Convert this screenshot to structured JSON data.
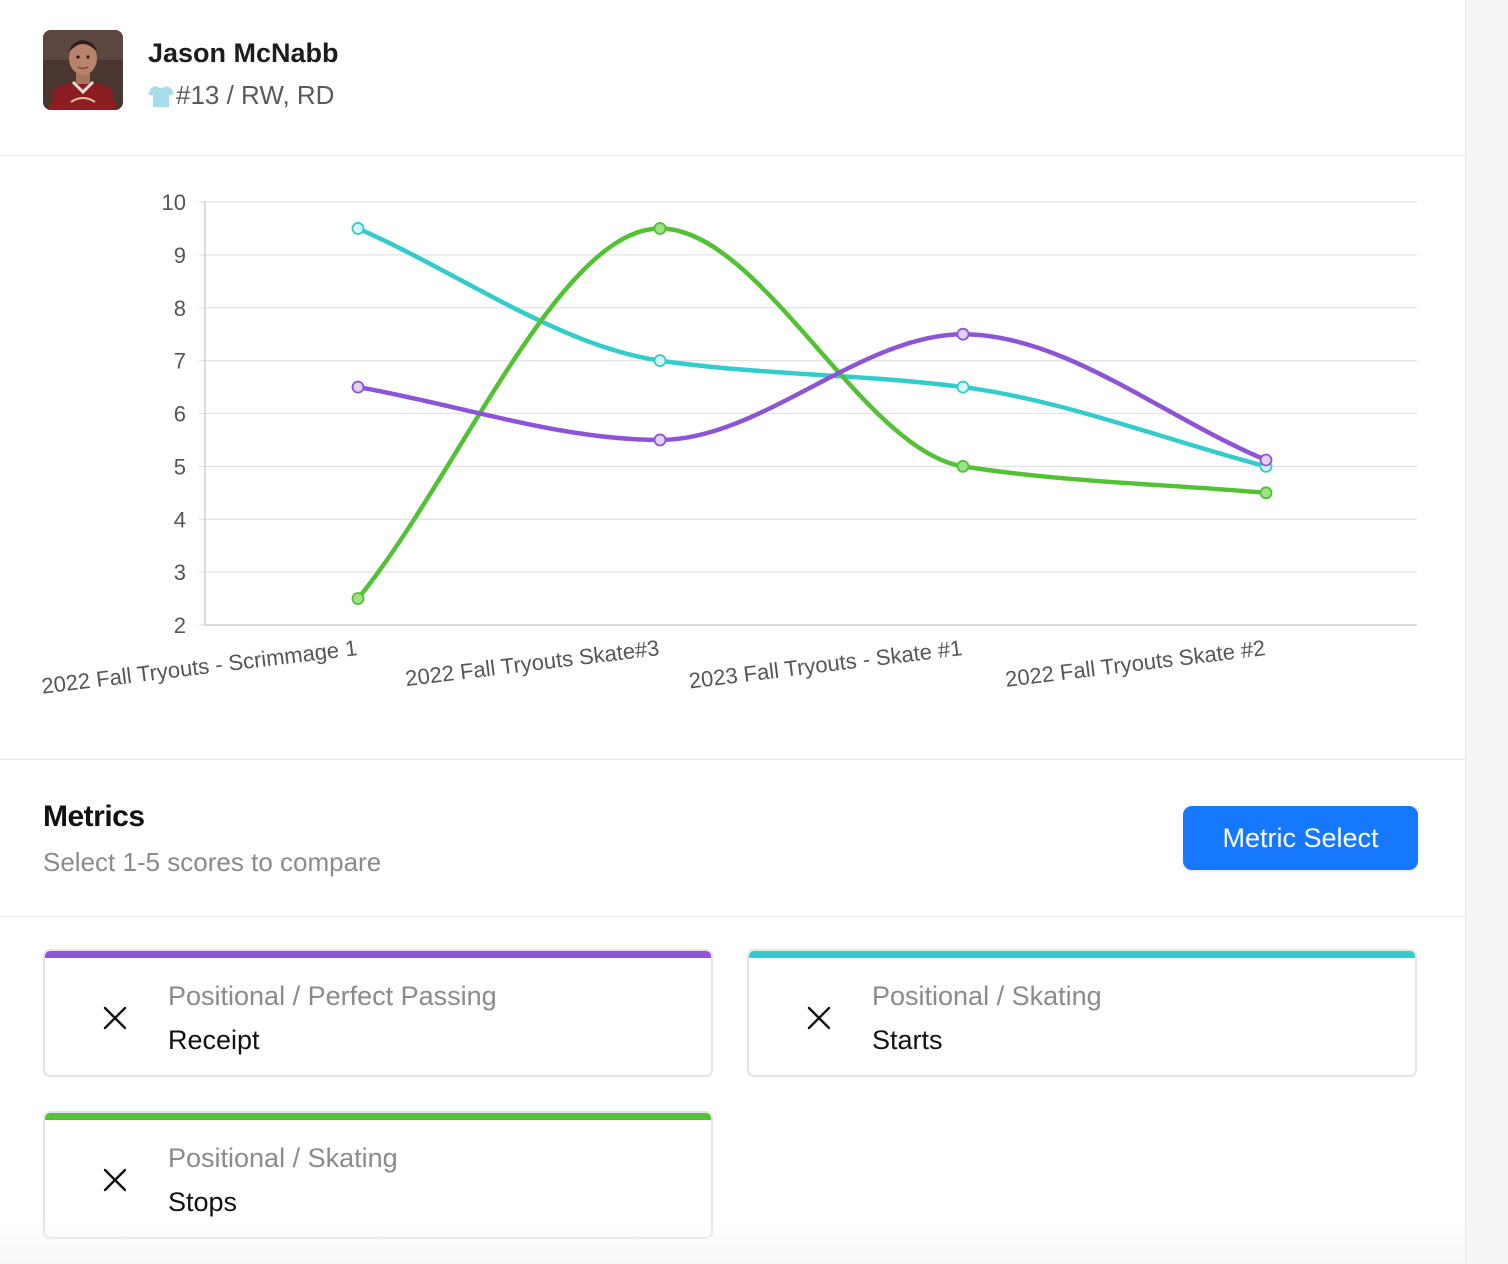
{
  "player": {
    "name": "Jason McNabb",
    "meta": "#13 / RW, RD",
    "jersey_icon": "jersey-icon"
  },
  "chart_data": {
    "type": "line",
    "categories": [
      "2022 Fall Tryouts - Scrimmage 1",
      "2022 Fall Tryouts Skate#3",
      "2023 Fall Tryouts - Skate #1",
      "2022 Fall Tryouts Skate #2"
    ],
    "ylim": [
      2,
      10
    ],
    "yticks": [
      "2",
      "3",
      "4",
      "5",
      "6",
      "7",
      "8",
      "9",
      "10"
    ],
    "grid": true,
    "smooth": true,
    "series": [
      {
        "color": "#33cccc",
        "values": [
          9.5,
          7.0,
          6.5,
          5.0
        ]
      },
      {
        "color": "#52c234",
        "values": [
          2.5,
          9.5,
          5.0,
          4.5
        ]
      },
      {
        "color": "#8e54d8",
        "values": [
          6.5,
          5.5,
          7.5,
          5.12
        ]
      }
    ]
  },
  "metrics": {
    "title": "Metrics",
    "subtitle": "Select 1-5 scores to compare",
    "select_button": "Metric Select",
    "cards": [
      {
        "color": "#8e54d8",
        "category": "Positional / Perfect Passing",
        "name": "Receipt",
        "close_icon": "close-icon"
      },
      {
        "color": "#33cccc",
        "category": "Positional / Skating",
        "name": "Starts",
        "close_icon": "close-icon"
      },
      {
        "color": "#52c234",
        "category": "Positional / Skating",
        "name": "Stops",
        "close_icon": "close-icon"
      }
    ]
  }
}
